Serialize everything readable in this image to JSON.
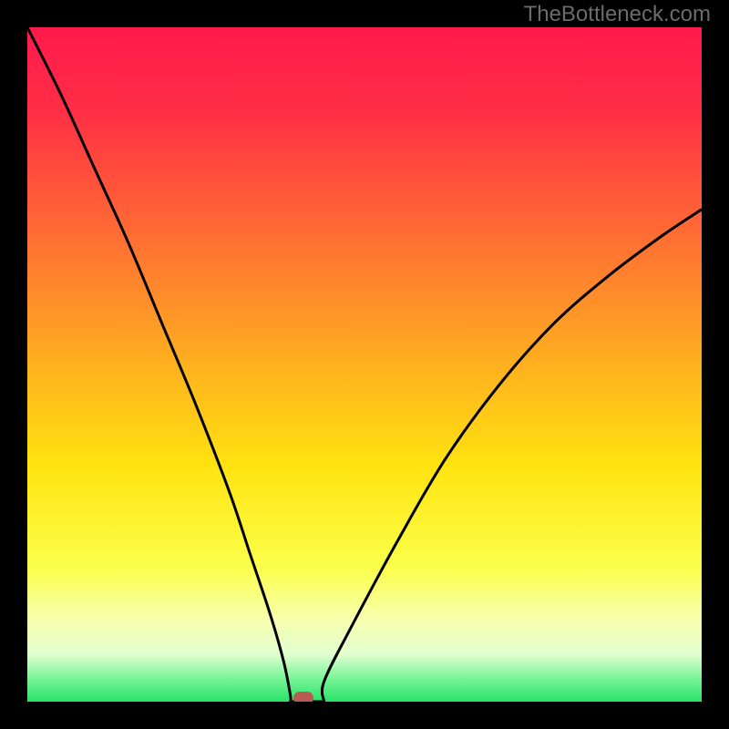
{
  "watermark": {
    "text": "TheBottleneck.com"
  },
  "colors": {
    "frame": "#000000",
    "curve": "#000000",
    "marker": "#bb5a53",
    "gradient_stops": [
      {
        "pct": 0,
        "hex": "#ff1a4b"
      },
      {
        "pct": 12,
        "hex": "#ff2d46"
      },
      {
        "pct": 30,
        "hex": "#ff6a34"
      },
      {
        "pct": 50,
        "hex": "#ffb01f"
      },
      {
        "pct": 65,
        "hex": "#ffe310"
      },
      {
        "pct": 80,
        "hex": "#fbff4a"
      },
      {
        "pct": 88,
        "hex": "#f7ffb0"
      },
      {
        "pct": 93,
        "hex": "#e0ffd0"
      },
      {
        "pct": 96,
        "hex": "#88f7a0"
      },
      {
        "pct": 100,
        "hex": "#27e36a"
      }
    ]
  },
  "chart_data": {
    "type": "line",
    "title": "",
    "xlabel": "",
    "ylabel": "",
    "xlim": [
      0,
      100
    ],
    "ylim": [
      0,
      100
    ],
    "series": [
      {
        "name": "bottleneck-curve",
        "x": [
          0,
          5,
          10,
          15,
          20,
          25,
          30,
          33,
          36,
          38,
          39,
          40,
          42,
          44,
          48,
          55,
          62,
          70,
          78,
          86,
          94,
          100
        ],
        "y": [
          100,
          90,
          79,
          68,
          56,
          44,
          31,
          22,
          13,
          6,
          1,
          0,
          0,
          3,
          11,
          24,
          36,
          47,
          56,
          63,
          69,
          73
        ]
      }
    ],
    "marker": {
      "x": 41,
      "y": 0.5,
      "name": "optimal-point"
    },
    "notch_x_range": [
      39,
      44
    ]
  }
}
